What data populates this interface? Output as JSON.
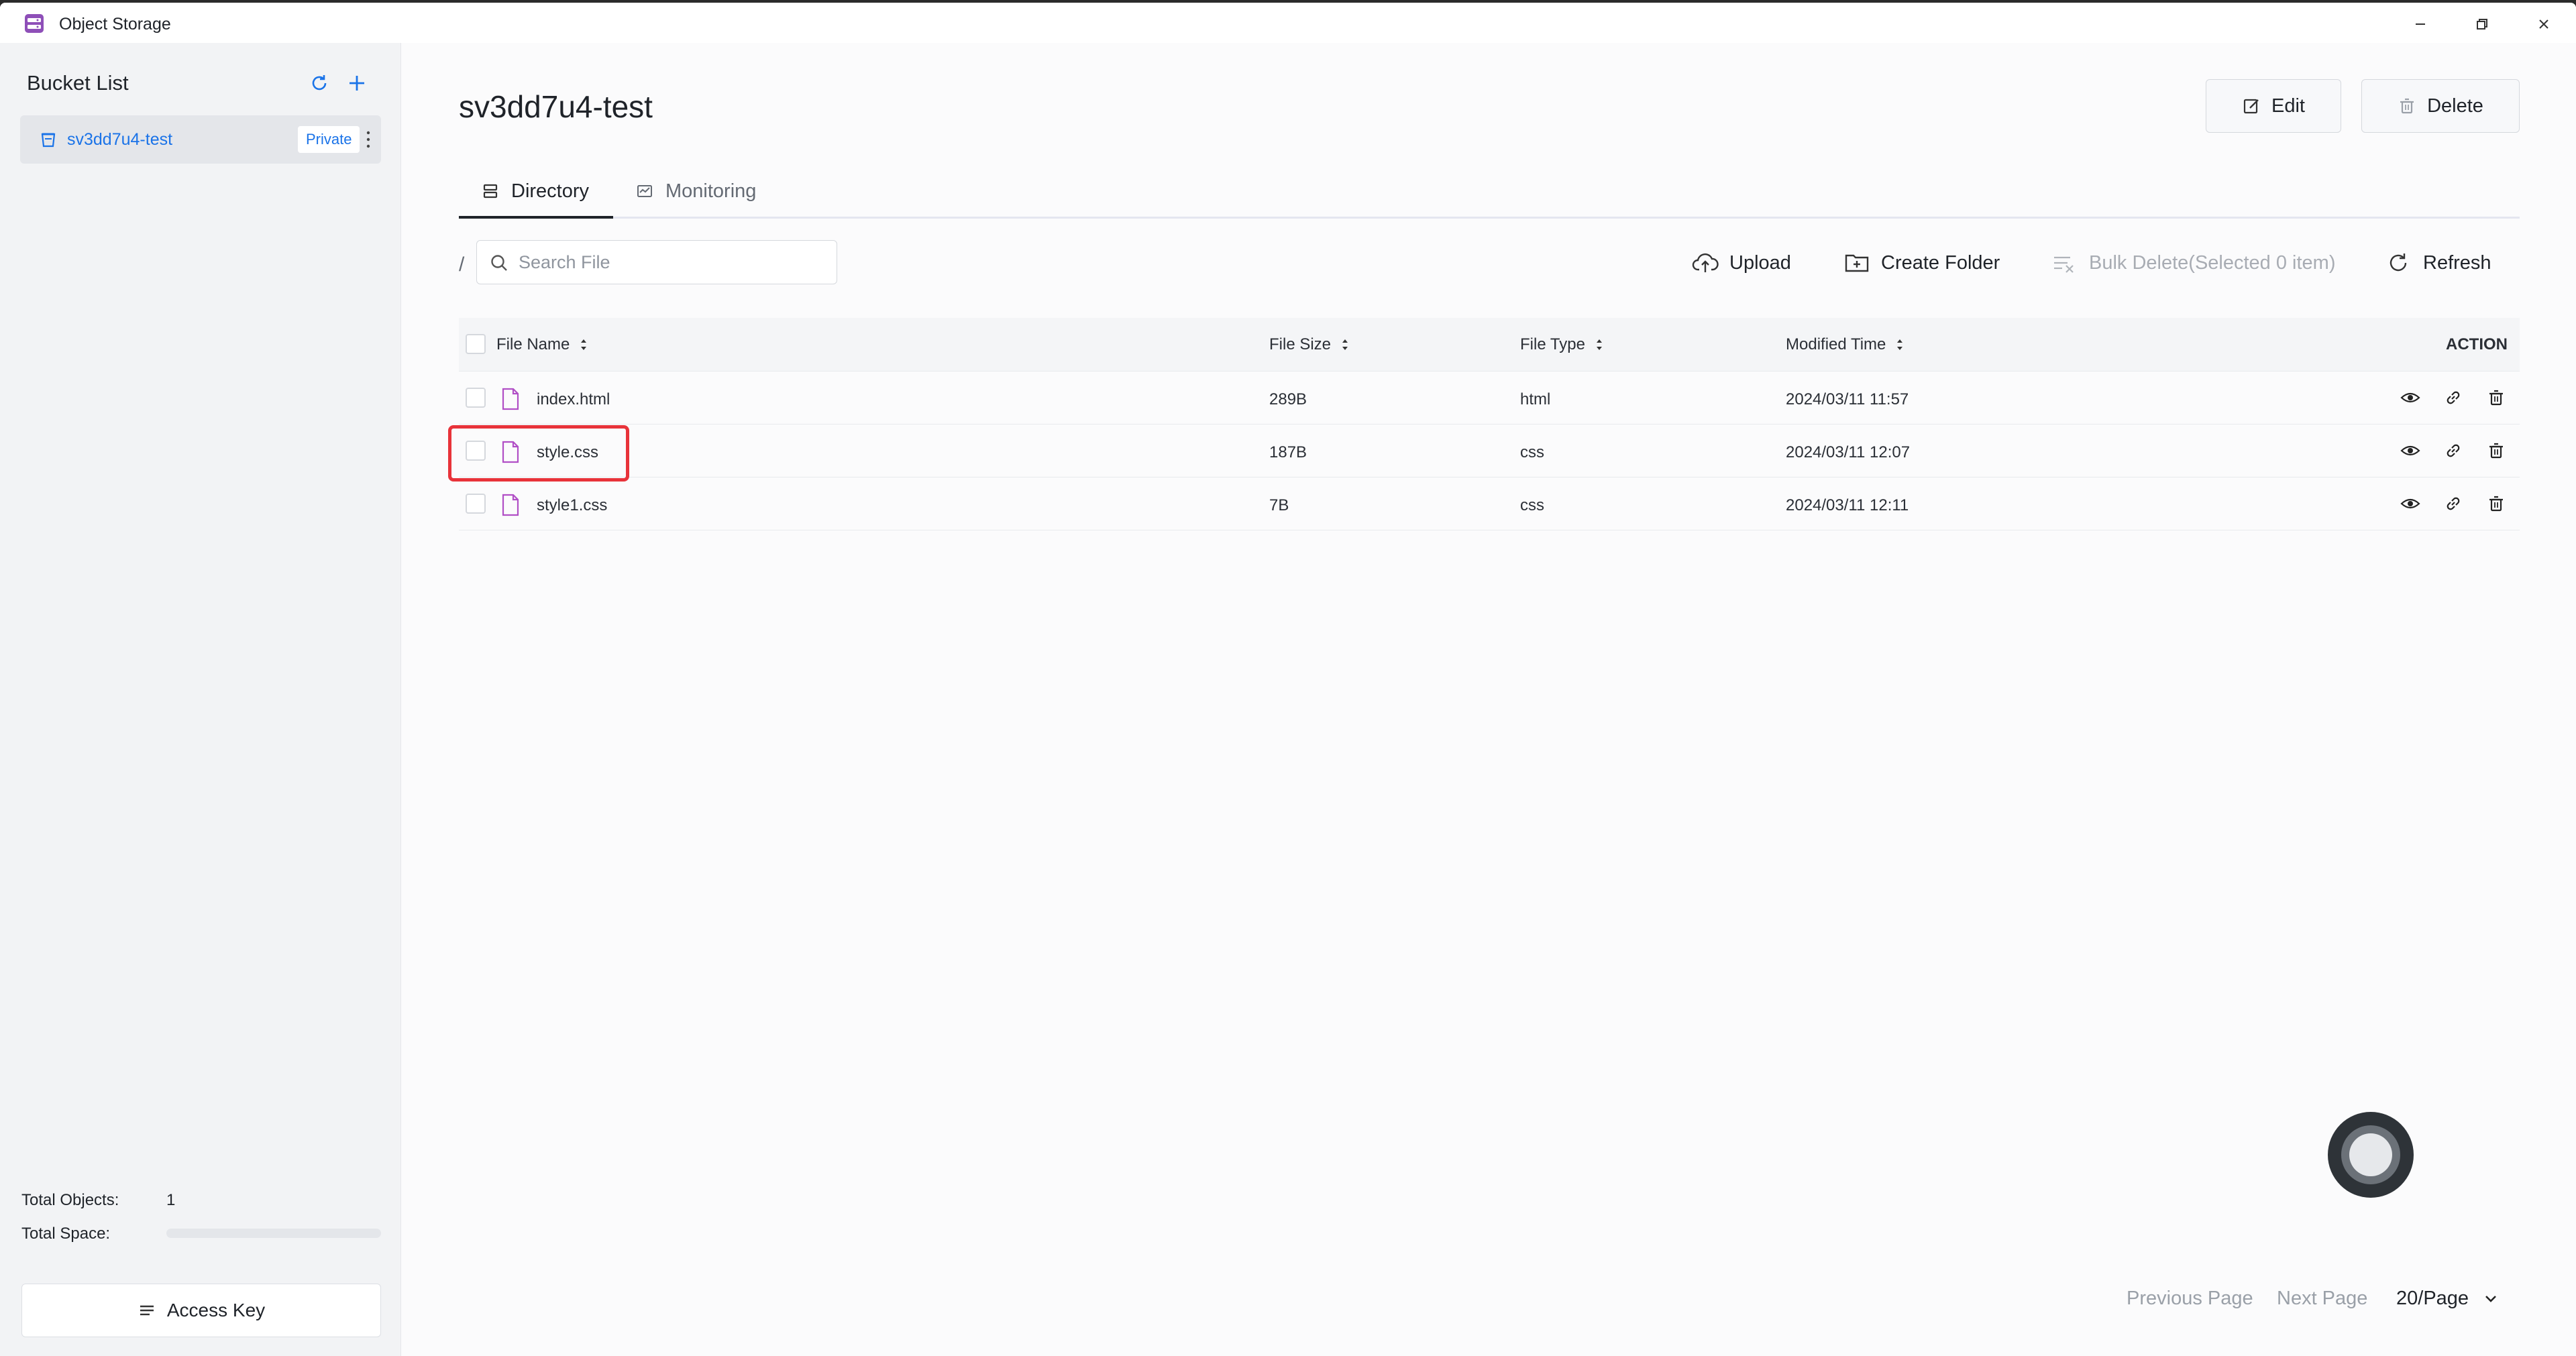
{
  "window": {
    "title": "Object Storage"
  },
  "sidebar": {
    "title": "Bucket List",
    "buckets": [
      {
        "name": "sv3dd7u4-test",
        "tag": "Private"
      }
    ],
    "stats": {
      "total_objects_label": "Total Objects:",
      "total_objects_value": "1",
      "total_space_label": "Total Space:",
      "total_space_used_fraction": 0
    },
    "access_key_label": "Access Key"
  },
  "main": {
    "title": "sv3dd7u4-test",
    "edit_label": "Edit",
    "delete_label": "Delete",
    "tabs": [
      {
        "label": "Directory",
        "active": true
      },
      {
        "label": "Monitoring",
        "active": false
      }
    ],
    "path": "/",
    "search": {
      "placeholder": "Search File",
      "value": ""
    },
    "toolbar": {
      "upload": "Upload",
      "create_folder": "Create Folder",
      "bulk_delete": "Bulk Delete(Selected 0 item)",
      "refresh": "Refresh"
    },
    "table": {
      "columns": [
        "File Name",
        "File Size",
        "File Type",
        "Modified Time",
        "ACTION"
      ],
      "rows": [
        {
          "name": "index.html",
          "size": "289B",
          "type": "html",
          "modified": "2024/03/11 11:57"
        },
        {
          "name": "style.css",
          "size": "187B",
          "type": "css",
          "modified": "2024/03/11 12:07"
        },
        {
          "name": "style1.css",
          "size": "7B",
          "type": "css",
          "modified": "2024/03/11 12:11"
        }
      ]
    },
    "pagination": {
      "previous": "Previous Page",
      "next": "Next Page",
      "page_size": "20/Page"
    }
  },
  "colors": {
    "accent": "#1a73e8",
    "file_icon": "#b14fc6",
    "highlight": "#e8333a"
  }
}
